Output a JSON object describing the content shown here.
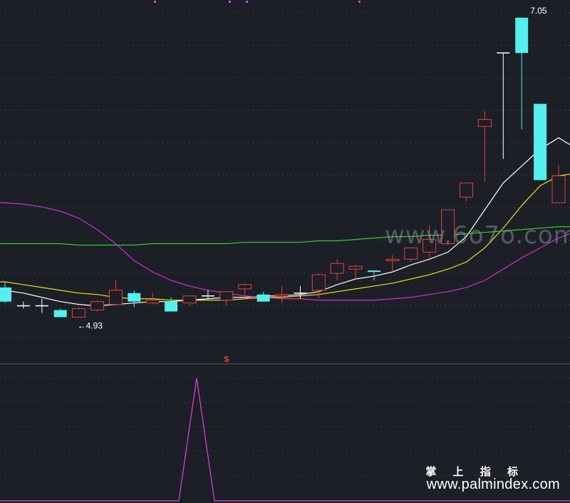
{
  "chart_data": [
    {
      "type": "candlestick",
      "title": "",
      "ylim": [
        4.7,
        7.15
      ],
      "grid": true,
      "annotations": {
        "high_label": "7.05",
        "low_label": "←4.93",
        "signal_marker": "S"
      },
      "candles": [
        {
          "o": 5.14,
          "h": 5.18,
          "l": 5.03,
          "c": 5.04
        },
        {
          "o": 5.01,
          "h": 5.04,
          "l": 4.99,
          "c": 5.01
        },
        {
          "o": 5.01,
          "h": 5.06,
          "l": 4.96,
          "c": 5.01
        },
        {
          "o": 4.98,
          "h": 4.99,
          "l": 4.93,
          "c": 4.93
        },
        {
          "o": 4.93,
          "h": 5.0,
          "l": 4.93,
          "c": 4.99
        },
        {
          "o": 4.98,
          "h": 5.05,
          "l": 4.97,
          "c": 5.04
        },
        {
          "o": 5.02,
          "h": 5.19,
          "l": 5.01,
          "c": 5.12
        },
        {
          "o": 5.1,
          "h": 5.12,
          "l": 5.0,
          "c": 5.04
        },
        {
          "o": 5.03,
          "h": 5.1,
          "l": 5.02,
          "c": 5.05
        },
        {
          "o": 5.04,
          "h": 5.07,
          "l": 4.97,
          "c": 4.97
        },
        {
          "o": 5.03,
          "h": 5.08,
          "l": 5.01,
          "c": 5.08
        },
        {
          "o": 5.08,
          "h": 5.12,
          "l": 5.06,
          "c": 5.08
        },
        {
          "o": 5.05,
          "h": 5.11,
          "l": 5.01,
          "c": 5.11
        },
        {
          "o": 5.13,
          "h": 5.17,
          "l": 5.06,
          "c": 5.16
        },
        {
          "o": 5.09,
          "h": 5.11,
          "l": 5.04,
          "c": 5.04
        },
        {
          "o": 5.08,
          "h": 5.15,
          "l": 5.03,
          "c": 5.09
        },
        {
          "o": 5.1,
          "h": 5.15,
          "l": 5.06,
          "c": 5.1
        },
        {
          "o": 5.12,
          "h": 5.24,
          "l": 5.06,
          "c": 5.23
        },
        {
          "o": 5.24,
          "h": 5.34,
          "l": 5.19,
          "c": 5.31
        },
        {
          "o": 5.27,
          "h": 5.3,
          "l": 5.2,
          "c": 5.29
        },
        {
          "o": 5.26,
          "h": 5.25,
          "l": 5.19,
          "c": 5.25
        },
        {
          "o": 5.33,
          "h": 5.37,
          "l": 5.25,
          "c": 5.34
        },
        {
          "o": 5.34,
          "h": 5.37,
          "l": 5.32,
          "c": 5.42
        },
        {
          "o": 5.39,
          "h": 5.58,
          "l": 5.35,
          "c": 5.48
        },
        {
          "o": 5.45,
          "h": 5.69,
          "l": 5.44,
          "c": 5.69
        },
        {
          "o": 5.78,
          "h": 5.87,
          "l": 5.75,
          "c": 5.88
        },
        {
          "o": 6.28,
          "h": 6.39,
          "l": 5.89,
          "c": 6.33
        },
        {
          "o": 6.8,
          "h": 6.56,
          "l": 6.05,
          "c": 6.8
        },
        {
          "o": 7.05,
          "h": 7.05,
          "l": 6.26,
          "c": 6.8
        },
        {
          "o": 6.44,
          "h": 6.44,
          "l": 5.9,
          "c": 5.9
        },
        {
          "o": 5.74,
          "h": 6.01,
          "l": 5.74,
          "c": 5.93
        },
        {
          "o": 5.89,
          "h": 5.95,
          "l": 5.82,
          "c": 5.86
        },
        {
          "o": 5.96,
          "h": 5.99,
          "l": 5.87,
          "c": 5.96
        }
      ],
      "series": [
        {
          "color": "#ffffff",
          "values": [
            5.12,
            5.1,
            5.07,
            5.04,
            5.02,
            5.01,
            5.02,
            5.03,
            5.04,
            5.04,
            5.05,
            5.06,
            5.07,
            5.07,
            5.08,
            5.08,
            5.09,
            5.11,
            5.16,
            5.2,
            5.22,
            5.25,
            5.3,
            5.34,
            5.39,
            5.5,
            5.69,
            5.88,
            6.0,
            6.12,
            6.2,
            6.12,
            5.98
          ]
        },
        {
          "color": "#e8e020",
          "values": [
            5.18,
            5.16,
            5.14,
            5.12,
            5.1,
            5.09,
            5.07,
            5.06,
            5.06,
            5.05,
            5.05,
            5.05,
            5.05,
            5.06,
            5.07,
            5.07,
            5.08,
            5.09,
            5.11,
            5.13,
            5.15,
            5.17,
            5.2,
            5.23,
            5.27,
            5.32,
            5.42,
            5.56,
            5.72,
            5.86,
            5.93,
            5.95,
            5.98
          ]
        },
        {
          "color": "#30d030",
          "values": [
            5.45,
            5.45,
            5.45,
            5.45,
            5.44,
            5.44,
            5.44,
            5.44,
            5.45,
            5.45,
            5.45,
            5.45,
            5.45,
            5.46,
            5.46,
            5.46,
            5.46,
            5.47,
            5.47,
            5.48,
            5.49,
            5.5,
            5.5,
            5.51,
            5.51,
            5.52,
            5.53,
            5.54,
            5.55,
            5.56,
            5.57,
            5.57,
            5.58
          ]
        },
        {
          "color": "#d030d0",
          "values": [
            5.74,
            5.73,
            5.71,
            5.68,
            5.63,
            5.55,
            5.45,
            5.33,
            5.25,
            5.19,
            5.15,
            5.12,
            5.1,
            5.08,
            5.07,
            5.06,
            5.06,
            5.05,
            5.05,
            5.05,
            5.05,
            5.06,
            5.07,
            5.09,
            5.11,
            5.14,
            5.19,
            5.27,
            5.35,
            5.42,
            5.49,
            5.54,
            5.6
          ]
        }
      ]
    },
    {
      "type": "line",
      "title": "",
      "ylim": [
        0,
        1
      ],
      "grid": true,
      "series": [
        {
          "color": "#e040e0",
          "values": [
            0,
            0,
            0,
            0,
            0,
            0,
            0,
            0,
            0,
            0,
            1,
            0,
            0,
            0,
            0,
            0,
            0,
            0,
            0,
            0,
            0,
            0,
            0,
            0,
            0,
            0,
            0,
            0,
            0,
            0,
            0,
            0,
            0
          ]
        }
      ]
    }
  ],
  "watermark": {
    "overlay": "www.6o7o.com",
    "brand": "掌 上 指 标",
    "site": "www.palmindex.com"
  }
}
